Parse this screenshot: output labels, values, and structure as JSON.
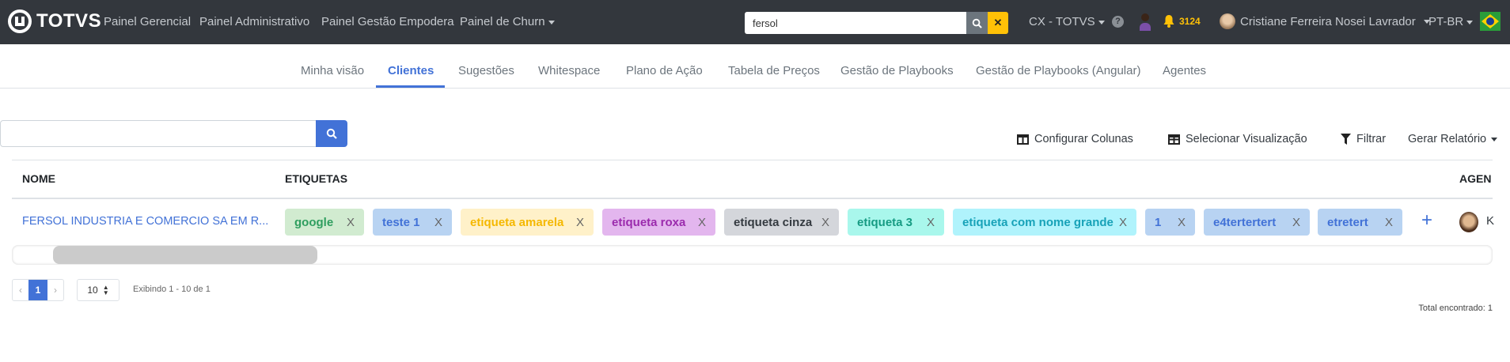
{
  "navbar": {
    "brand": "TOTVS",
    "links": [
      "Painel Gerencial",
      "Painel Administrativo",
      "Painel Gestão Empodera",
      "Painel de Churn"
    ],
    "search_value": "fersol",
    "company": "CX - TOTVS",
    "notifications": "3124",
    "user": "Cristiane Ferreira Nosei Lavrador",
    "language": "PT-BR",
    "colors": {
      "bg": "#33373d",
      "accent": "#ffc107"
    }
  },
  "tabs": [
    {
      "label": "Minha visão"
    },
    {
      "label": "Clientes",
      "active": true
    },
    {
      "label": "Sugestões"
    },
    {
      "label": "Whitespace"
    },
    {
      "label": "Plano de Ação"
    },
    {
      "label": "Tabela de Preços"
    },
    {
      "label": "Gestão de Playbooks"
    },
    {
      "label": "Gestão de Playbooks (Angular)"
    },
    {
      "label": "Agentes"
    }
  ],
  "search": {
    "value": "",
    "placeholder": ""
  },
  "toolbar": {
    "configure_columns": "Configurar Colunas",
    "select_view": "Selecionar Visualização",
    "filter": "Filtrar",
    "report": "Gerar Relatório"
  },
  "table": {
    "headers": [
      "NOME",
      "ETIQUETAS",
      "AGEN"
    ],
    "rows": [
      {
        "name": "FERSOL INDUSTRIA E COMERCIO SA EM R...",
        "tags": [
          {
            "label": "google",
            "bg": "#d1ebd0",
            "fg": "#2f9e5f"
          },
          {
            "label": "teste 1",
            "bg": "#b8d3f2",
            "fg": "#4272d7"
          },
          {
            "label": "etiqueta amarela",
            "bg": "#fff1c9",
            "fg": "#f5b800"
          },
          {
            "label": "etiqueta roxa",
            "bg": "#e3b6ee",
            "fg": "#9b2bad"
          },
          {
            "label": "etiqueta cinza",
            "bg": "#d4d6db",
            "fg": "#343a40"
          },
          {
            "label": "etiqueta 3",
            "bg": "#a9f7ec",
            "fg": "#169b83"
          },
          {
            "label": "etiqueta com nome grande",
            "bg": "#b0f3fc",
            "fg": "#17a2b8"
          },
          {
            "label": "1",
            "bg": "#b8d3f2",
            "fg": "#4272d7"
          },
          {
            "label": "e4tertertert",
            "bg": "#b8d3f2",
            "fg": "#4272d7"
          },
          {
            "label": "etretert",
            "bg": "#b8d3f2",
            "fg": "#4272d7"
          }
        ],
        "remove_label": "X",
        "add_label": "+",
        "agent_initial": "K"
      }
    ]
  },
  "pagination": {
    "prev": "‹",
    "current": "1",
    "next": "›",
    "page_size": "10",
    "showing": "Exibindo 1 - 10 de 1",
    "total": "Total encontrado: 1"
  }
}
